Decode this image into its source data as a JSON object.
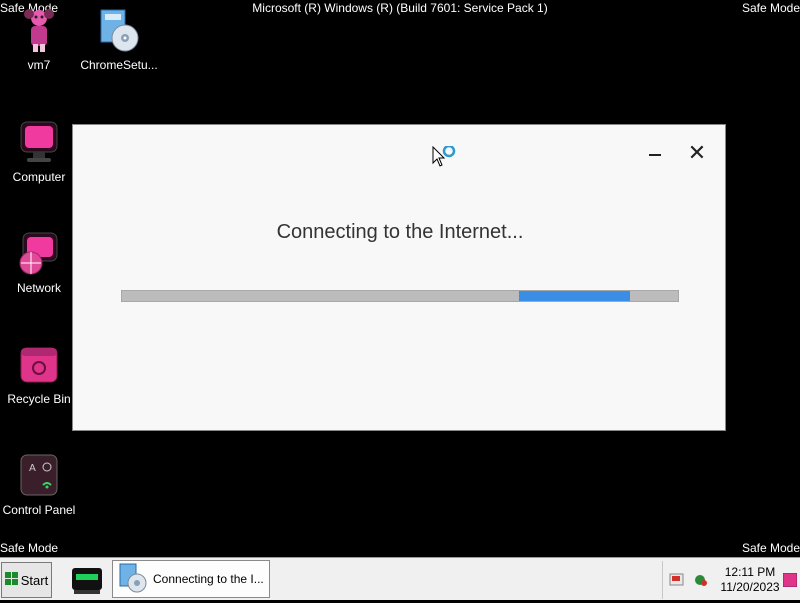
{
  "safe_mode": {
    "top_left": "Safe Mode",
    "top_right": "Safe Mode",
    "bottom_left": "Safe Mode",
    "bottom_right": "Safe Mode"
  },
  "os_title": "Microsoft (R) Windows (R) (Build 7601: Service Pack 1)",
  "desktop_icons": [
    {
      "label": "vm7",
      "icon": "doll-icon"
    },
    {
      "label": "ChromeSetu...",
      "icon": "installer-icon"
    },
    {
      "label": "Computer",
      "icon": "computer-icon"
    },
    {
      "label": "Network",
      "icon": "network-icon"
    },
    {
      "label": "Recycle Bin",
      "icon": "recycle-bin-icon"
    },
    {
      "label": "Control Panel",
      "icon": "control-panel-icon"
    }
  ],
  "dialog": {
    "status_text": "Connecting to the Internet...",
    "minimize_icon": "minimize-icon",
    "close_symbol": "✕",
    "progress": "indeterminate"
  },
  "taskbar": {
    "start_label": "Start",
    "task_label": "Connecting to the I...",
    "clock_time": "12:11 PM",
    "clock_date": "11/20/2023"
  },
  "colors": {
    "desktop": "#000000",
    "dialog_bg": "#f8f8f8",
    "progress_track": "#bcbcbc",
    "progress_chunk": "#3a8ee6",
    "accent_pink": "#e0338a"
  }
}
